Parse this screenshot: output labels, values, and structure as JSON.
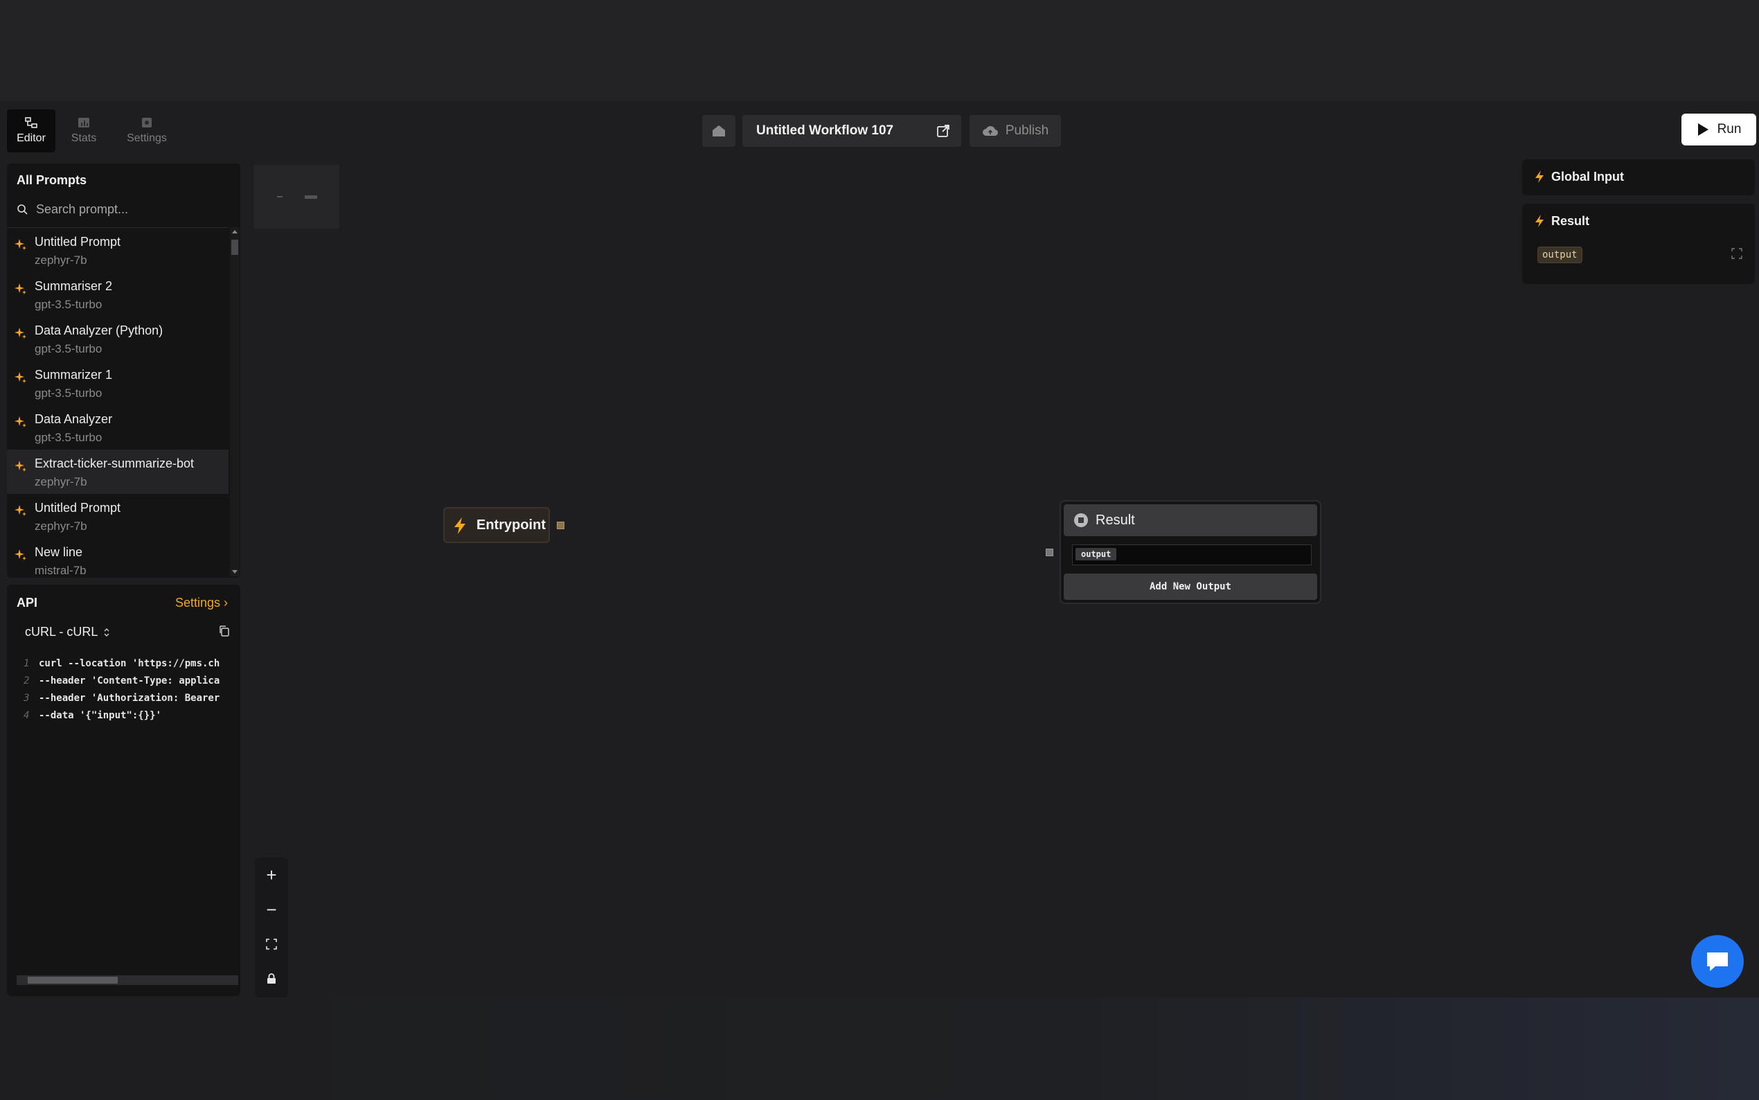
{
  "tabs": [
    {
      "label": "Editor",
      "icon": "workflow-icon",
      "active": true
    },
    {
      "label": "Stats",
      "icon": "chart-icon",
      "active": false
    },
    {
      "label": "Settings",
      "icon": "settings-icon",
      "active": false
    }
  ],
  "prompts": {
    "title": "All Prompts",
    "search_placeholder": "Search prompt...",
    "items": [
      {
        "name": "Untitled Prompt",
        "model": "zephyr-7b"
      },
      {
        "name": "Summariser 2",
        "model": "gpt-3.5-turbo"
      },
      {
        "name": "Data Analyzer (Python)",
        "model": "gpt-3.5-turbo"
      },
      {
        "name": "Summarizer 1",
        "model": "gpt-3.5-turbo"
      },
      {
        "name": "Data Analyzer",
        "model": "gpt-3.5-turbo"
      },
      {
        "name": "Extract-ticker-summarize-bot",
        "model": "zephyr-7b"
      },
      {
        "name": "Untitled Prompt",
        "model": "zephyr-7b"
      },
      {
        "name": "New line",
        "model": "mistral-7b"
      }
    ]
  },
  "api": {
    "title": "API",
    "settings_label": "Settings",
    "settings_chevron": "›",
    "language": "cURL - cURL",
    "code_lines": [
      {
        "n": "1",
        "text": "curl --location 'https://pms.ch"
      },
      {
        "n": "2",
        "text": "--header 'Content-Type: applica"
      },
      {
        "n": "3",
        "text": "--header 'Authorization: Bearer"
      },
      {
        "n": "4",
        "text": "--data '{\"input\":{}}'"
      }
    ]
  },
  "header": {
    "workflow_title": "Untitled Workflow 107",
    "publish_label": "Publish",
    "run_label": "Run"
  },
  "right_panel": {
    "global_input_label": "Global Input",
    "result_label": "Result",
    "result_tag": "output"
  },
  "nodes": {
    "entrypoint_label": "Entrypoint",
    "result_label": "Result",
    "output_tag": "output",
    "add_output_label": "Add New Output"
  },
  "zoom": {
    "plus": "+",
    "minus": "−"
  },
  "colors": {
    "accent": "#f5a623",
    "chat_button": "#1e74f0",
    "background": "#1e1e20"
  }
}
